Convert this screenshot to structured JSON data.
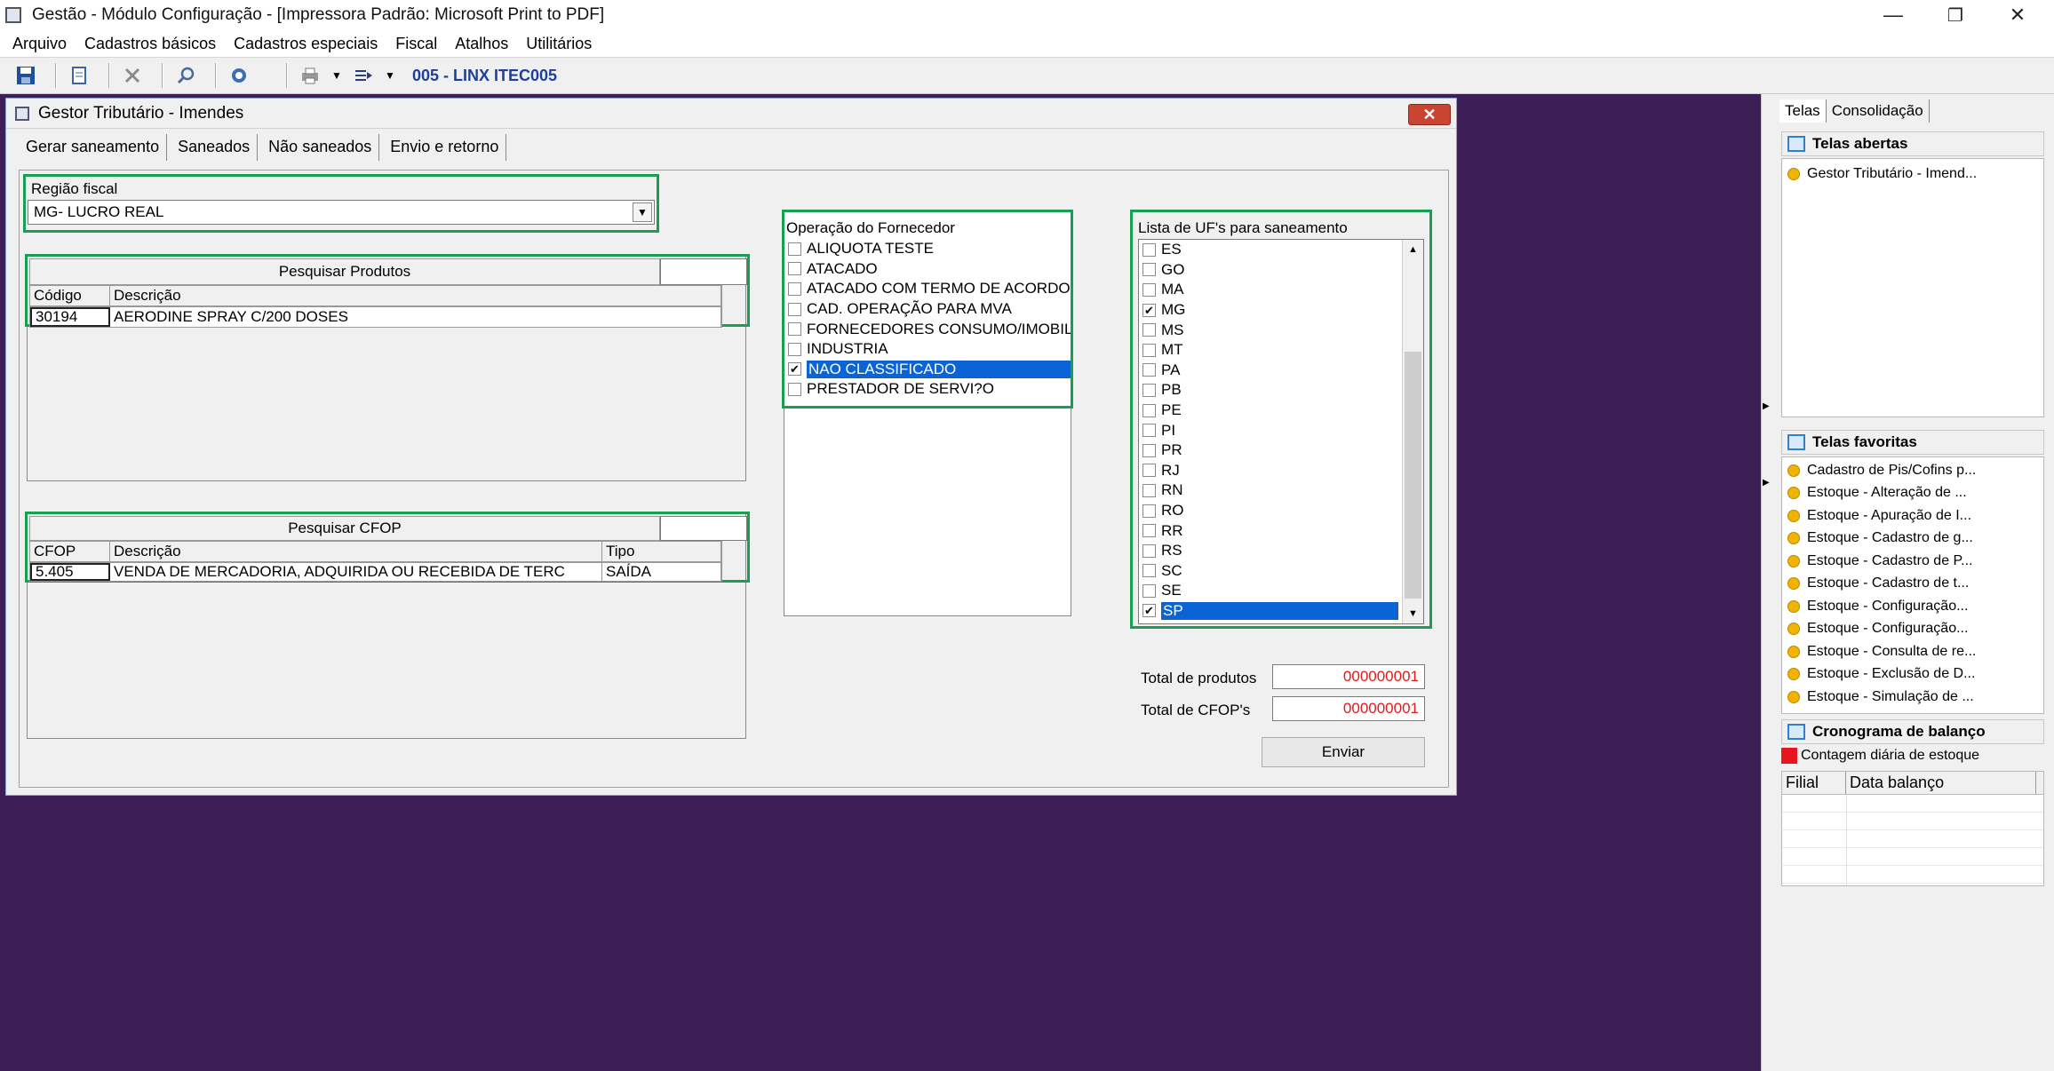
{
  "app": {
    "title": "Gestão  - Módulo Configuração - [Impressora Padrão: Microsoft Print to PDF]",
    "controls": {
      "minimize": "—",
      "restore": "❐",
      "close": "✕"
    }
  },
  "menu": [
    "Arquivo",
    "Cadastros básicos",
    "Cadastros especiais",
    "Fiscal",
    "Atalhos",
    "Utilitários"
  ],
  "toolbar": {
    "company": "005 - LINX ITEC005"
  },
  "child": {
    "title": "Gestor Tributário - Imendes",
    "close": "✕",
    "tabs": [
      "Gerar saneamento",
      "Saneados",
      "Não saneados",
      "Envio e retorno"
    ],
    "regiao": {
      "label": "Região fiscal",
      "value": "MG- LUCRO REAL"
    },
    "produtos": {
      "title": "Pesquisar Produtos",
      "columns": [
        "Código",
        "Descrição"
      ],
      "rows": [
        {
          "codigo": "30194",
          "descricao": "AERODINE SPRAY C/200 DOSES"
        }
      ]
    },
    "cfop": {
      "title": "Pesquisar CFOP",
      "columns": [
        "CFOP",
        "Descrição",
        "Tipo"
      ],
      "rows": [
        {
          "cfop": "5.405",
          "descricao": "VENDA DE MERCADORIA, ADQUIRIDA OU RECEBIDA DE TERC",
          "tipo": "SAÍDA"
        }
      ]
    },
    "operacao": {
      "label": "Operação do Fornecedor",
      "items": [
        {
          "label": "ALIQUOTA TESTE",
          "checked": false,
          "selected": false
        },
        {
          "label": "ATACADO",
          "checked": false,
          "selected": false
        },
        {
          "label": "ATACADO COM TERMO DE ACORDO",
          "checked": false,
          "selected": false
        },
        {
          "label": "CAD. OPERAÇÃO PARA MVA",
          "checked": false,
          "selected": false
        },
        {
          "label": "FORNECEDORES CONSUMO/IMOBILIZ",
          "checked": false,
          "selected": false
        },
        {
          "label": "INDUSTRIA",
          "checked": false,
          "selected": false
        },
        {
          "label": "NAO CLASSIFICADO",
          "checked": true,
          "selected": true
        },
        {
          "label": "PRESTADOR DE SERVI?O",
          "checked": false,
          "selected": false
        }
      ]
    },
    "uf": {
      "label": "Lista de UF's para saneamento",
      "items": [
        {
          "label": "ES",
          "checked": false,
          "selected": false
        },
        {
          "label": "GO",
          "checked": false,
          "selected": false
        },
        {
          "label": "MA",
          "checked": false,
          "selected": false
        },
        {
          "label": "MG",
          "checked": true,
          "selected": false
        },
        {
          "label": "MS",
          "checked": false,
          "selected": false
        },
        {
          "label": "MT",
          "checked": false,
          "selected": false
        },
        {
          "label": "PA",
          "checked": false,
          "selected": false
        },
        {
          "label": "PB",
          "checked": false,
          "selected": false
        },
        {
          "label": "PE",
          "checked": false,
          "selected": false
        },
        {
          "label": "PI",
          "checked": false,
          "selected": false
        },
        {
          "label": "PR",
          "checked": false,
          "selected": false
        },
        {
          "label": "RJ",
          "checked": false,
          "selected": false
        },
        {
          "label": "RN",
          "checked": false,
          "selected": false
        },
        {
          "label": "RO",
          "checked": false,
          "selected": false
        },
        {
          "label": "RR",
          "checked": false,
          "selected": false
        },
        {
          "label": "RS",
          "checked": false,
          "selected": false
        },
        {
          "label": "SC",
          "checked": false,
          "selected": false
        },
        {
          "label": "SE",
          "checked": false,
          "selected": false
        },
        {
          "label": "SP",
          "checked": true,
          "selected": true
        }
      ]
    },
    "totals": {
      "produtos_label": "Total de produtos",
      "produtos_value": "000000001",
      "cfops_label": "Total de CFOP's",
      "cfops_value": "000000001"
    },
    "enviar": "Enviar"
  },
  "right_panel": {
    "tabs": [
      "Telas",
      "Consolidação"
    ],
    "abertas": {
      "title": "Telas abertas",
      "items": [
        "Gestor Tributário - Imend..."
      ]
    },
    "favoritas": {
      "title": "Telas favoritas",
      "items": [
        "Cadastro de Pis/Cofins p...",
        "Estoque - Alteração de ...",
        "Estoque - Apuração de I...",
        "Estoque - Cadastro de g...",
        "Estoque - Cadastro de P...",
        "Estoque - Cadastro de t...",
        "Estoque - Configuração...",
        "Estoque - Configuração...",
        "Estoque - Consulta de re...",
        "Estoque - Exclusão de D...",
        "Estoque - Simulação de ..."
      ]
    },
    "cronograma": {
      "title": "Cronograma de balanço",
      "legend": "Contagem diária de estoque",
      "legend_color": "#e8141e",
      "columns": [
        "Filial",
        "Data balanço"
      ]
    }
  }
}
